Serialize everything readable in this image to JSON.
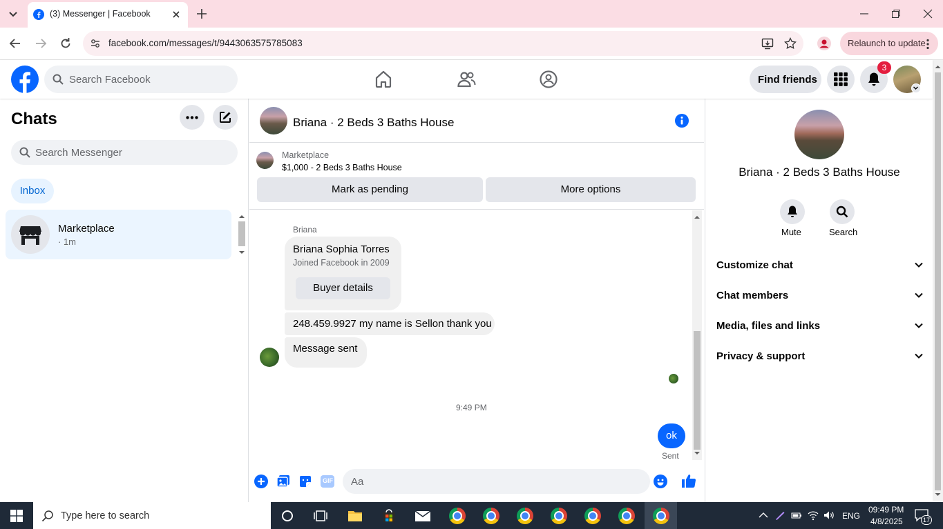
{
  "browser": {
    "tab_title": "(3) Messenger | Facebook",
    "url": "facebook.com/messages/t/9443063575785083",
    "relaunch_label": "Relaunch to update"
  },
  "fb_header": {
    "search_placeholder": "Search Facebook",
    "find_friends_label": "Find friends",
    "notification_count": "3"
  },
  "chat_list": {
    "title": "Chats",
    "search_placeholder": "Search Messenger",
    "filter_label": "Inbox",
    "items": [
      {
        "name": "Marketplace",
        "subtitle": "· 1m"
      }
    ]
  },
  "conversation": {
    "title": "Briana · 2 Beds 3 Baths House",
    "marketplace_label": "Marketplace",
    "listing": "$1,000 - 2 Beds 3 Baths House",
    "mark_pending_label": "Mark as pending",
    "more_options_label": "More options",
    "sender_name": "Briana",
    "buyer_card": {
      "name": "Briana Sophia Torres",
      "joined": "Joined Facebook in 2009",
      "button_label": "Buyer details"
    },
    "messages": [
      {
        "from": "Briana",
        "text": "248.459.9927 my name is Sellon thank you"
      },
      {
        "from": "Briana",
        "text": "Message sent"
      },
      {
        "from": "me",
        "text": "ok",
        "status": "Sent"
      }
    ],
    "timestamp": "9:49 PM",
    "composer_placeholder": "Aa",
    "gif_label": "GIF"
  },
  "info_panel": {
    "name": "Briana · 2 Beds 3 Baths House",
    "mute_label": "Mute",
    "search_label": "Search",
    "sections": [
      "Customize chat",
      "Chat members",
      "Media, files and links",
      "Privacy & support"
    ]
  },
  "taskbar": {
    "search_placeholder": "Type here to search",
    "language": "ENG",
    "time": "09:49 PM",
    "date": "4/8/2025",
    "notification_count": "17"
  },
  "colors": {
    "fb_blue": "#0866ff",
    "notification_red": "#e41e3f",
    "tab_strip": "#fbdde4"
  }
}
